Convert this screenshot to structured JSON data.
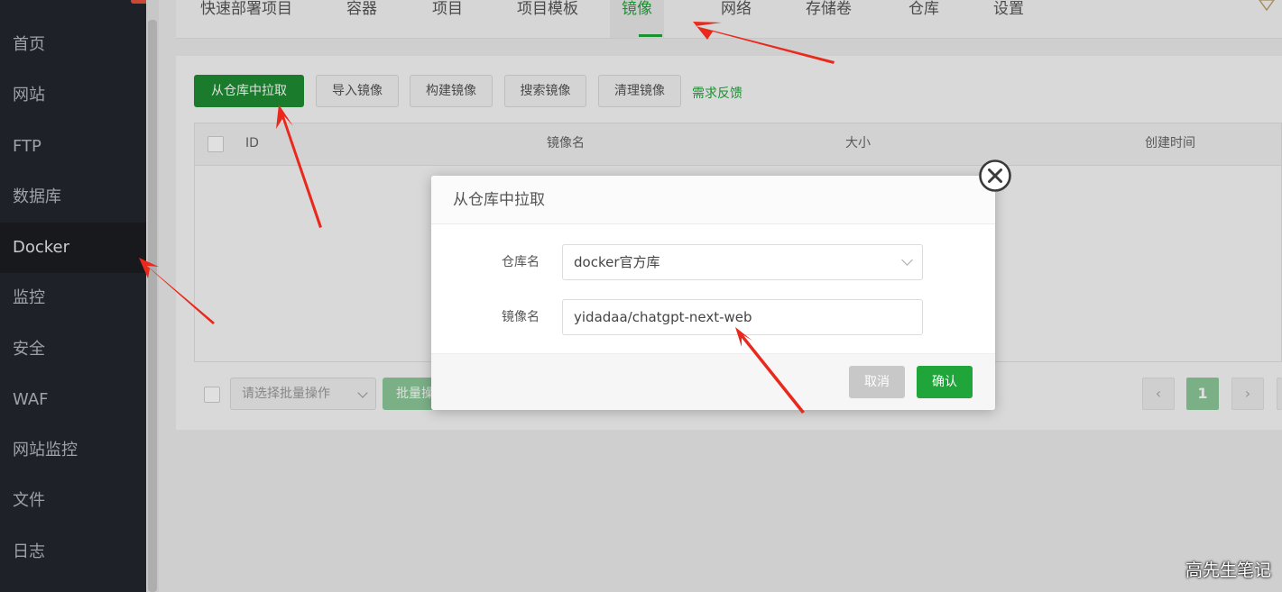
{
  "sidebar": {
    "items": [
      {
        "label": "首页"
      },
      {
        "label": "网站"
      },
      {
        "label": "FTP"
      },
      {
        "label": "数据库"
      },
      {
        "label": "Docker",
        "active": true
      },
      {
        "label": "监控"
      },
      {
        "label": "安全"
      },
      {
        "label": "WAF"
      },
      {
        "label": "网站监控"
      },
      {
        "label": "文件"
      },
      {
        "label": "日志"
      }
    ]
  },
  "tabs": [
    {
      "label": "快速部署项目"
    },
    {
      "label": "容器"
    },
    {
      "label": "项目"
    },
    {
      "label": "项目模板"
    },
    {
      "label": "镜像",
      "active": true
    },
    {
      "label": "网络"
    },
    {
      "label": "存储卷"
    },
    {
      "label": "仓库"
    },
    {
      "label": "设置"
    }
  ],
  "toolbar": {
    "pull_label": "从仓库中拉取",
    "import_label": "导入镜像",
    "build_label": "构建镜像",
    "search_label": "搜索镜像",
    "clean_label": "清理镜像",
    "feedback_label": "需求反馈"
  },
  "table": {
    "columns": [
      "ID",
      "镜像名",
      "大小",
      "创建时间"
    ]
  },
  "footer": {
    "batch_placeholder": "请选择批量操作",
    "batch_button": "批量操作",
    "current_page": "1",
    "prev": "‹",
    "next": "›"
  },
  "modal": {
    "title": "从仓库中拉取",
    "repo_label": "仓库名",
    "repo_value": "docker官方库",
    "image_label": "镜像名",
    "image_value": "yidadaa/chatgpt-next-web",
    "cancel_label": "取消",
    "confirm_label": "确认"
  },
  "watermark": "高先生笔记",
  "colors": {
    "accent": "#20a53a",
    "sidebar_bg": "#23262d",
    "annotation_arrow": "#e8291c"
  }
}
